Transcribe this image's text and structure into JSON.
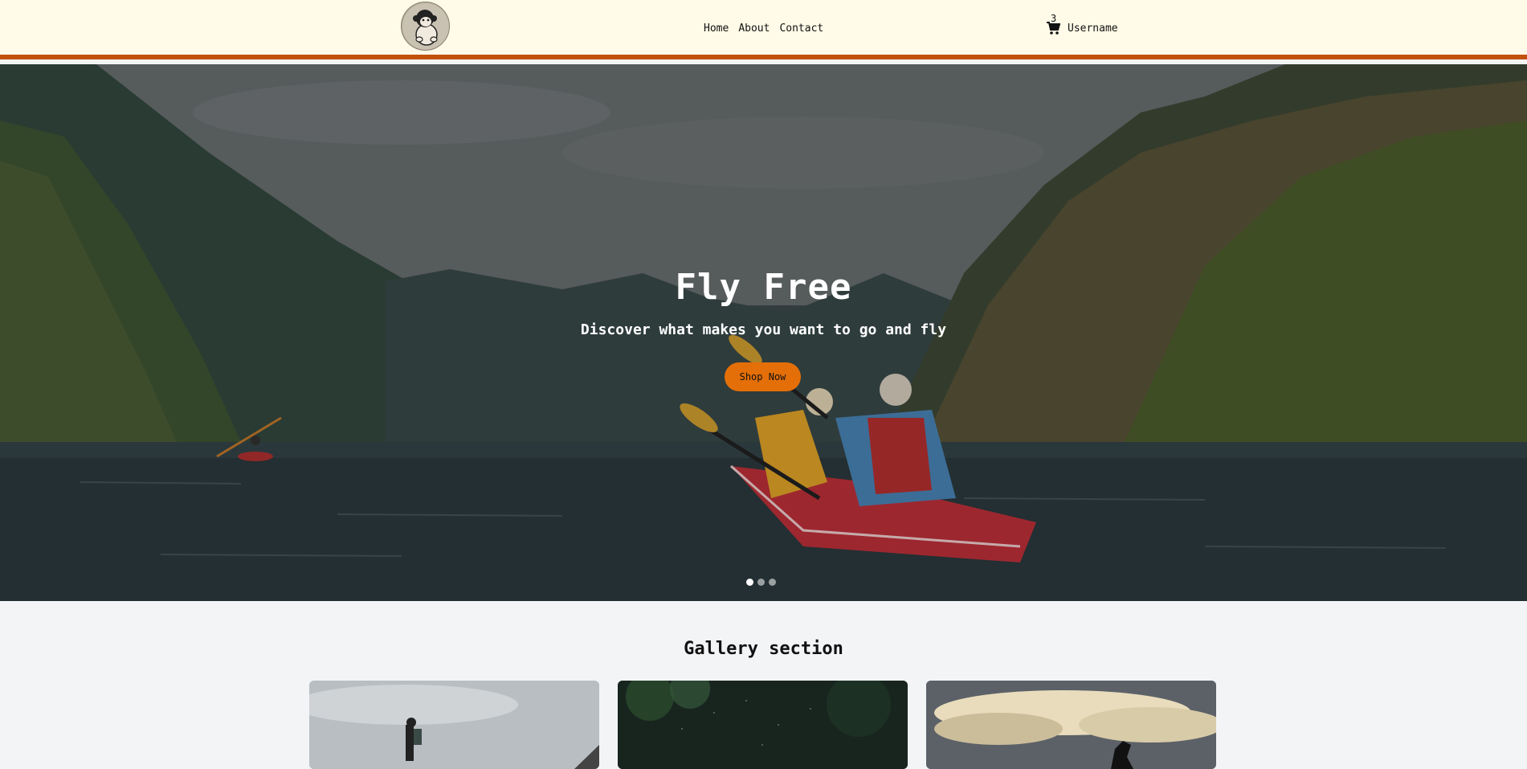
{
  "navbar": {
    "logo": "monkey-mascot-logo",
    "links": [
      {
        "label": "Home"
      },
      {
        "label": "About"
      },
      {
        "label": "Contact"
      }
    ],
    "cart_icon": "shopping-cart-icon",
    "cart_count": "3",
    "username": "Username",
    "accent_color": "#c2520a",
    "background_color": "#fffbe8"
  },
  "hero": {
    "title": "Fly Free",
    "subtitle": "Discover what makes you want to go and fly",
    "button_label": "Shop Now",
    "button_color": "#e46f08",
    "slide_count": 3,
    "active_slide": 1
  },
  "gallery": {
    "title": "Gallery section",
    "cards": [
      {
        "image": "hiker-mountain-photo"
      },
      {
        "image": "dark-forest-photo"
      },
      {
        "image": "cloudy-sky-bird-photo"
      }
    ]
  }
}
